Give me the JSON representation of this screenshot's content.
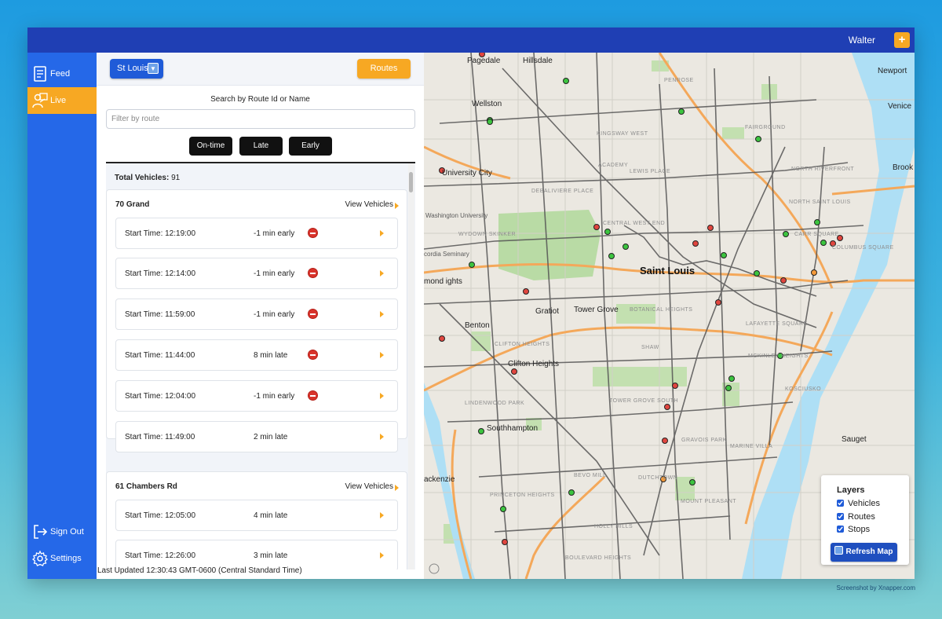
{
  "app": {
    "username": "Walter",
    "add_label": "+"
  },
  "sidebar": {
    "items": [
      {
        "label": "Feed",
        "icon": "document-icon"
      },
      {
        "label": "Live",
        "icon": "person-presentation-icon",
        "active": true
      }
    ],
    "bottom": [
      {
        "label": "Sign Out",
        "icon": "sign-out-icon"
      },
      {
        "label": "Settings",
        "icon": "gear-icon"
      }
    ]
  },
  "panel": {
    "city": "St Louis",
    "routes_label": "Routes",
    "search_label": "Search by Route Id or Name",
    "filter_placeholder": "Filter by route",
    "filters": [
      "On-time",
      "Late",
      "Early"
    ],
    "total_label": "Total Vehicles:",
    "total_value": "91",
    "view_vehicles_label": "View Vehicles",
    "routes": [
      {
        "name": "70 Grand",
        "trips": [
          {
            "start": "Start Time: 12:19:00",
            "status": "-1 min early",
            "alert": true
          },
          {
            "start": "Start Time: 12:14:00",
            "status": "-1 min early",
            "alert": true
          },
          {
            "start": "Start Time: 11:59:00",
            "status": "-1 min early",
            "alert": true
          },
          {
            "start": "Start Time: 11:44:00",
            "status": "8 min late",
            "alert": true
          },
          {
            "start": "Start Time: 12:04:00",
            "status": "-1 min early",
            "alert": true
          },
          {
            "start": "Start Time: 11:49:00",
            "status": "2 min late",
            "alert": false
          }
        ]
      },
      {
        "name": "61 Chambers Rd",
        "trips": [
          {
            "start": "Start Time: 12:05:00",
            "status": "4 min late",
            "alert": false
          },
          {
            "start": "Start Time: 12:26:00",
            "status": "3 min late",
            "alert": false
          }
        ]
      }
    ],
    "last_updated": "Last Updated 12:30:43 GMT-0600 (Central Standard Time)"
  },
  "map": {
    "labels": {
      "pagedale": "Pagedale",
      "hillsdale": "Hillsdale",
      "wellston": "Wellston",
      "university_city": "University City",
      "washington_university": "Washington University",
      "saint_louis": "Saint Louis",
      "benton": "Benton",
      "gratiot": "Gratiot",
      "tower_grove": "Tower Grove",
      "clifton_heights": "Clifton Heights",
      "southhampton": "Southhampton",
      "mackenzie": "ackenzie",
      "richmond_heights": "mond\nights",
      "newport": "Newport",
      "venice": "Venice",
      "brooklyn": "Brook",
      "sauget": "Sauget",
      "concordia": "cordia Seminary",
      "academy": "ACADEMY",
      "kingsway": "KINGSWAY WEST",
      "penrose": "PENROSE",
      "fairground": "FAIRGROUND",
      "north_riverfront": "NORTH RIVERFRONT",
      "north_saint_louis": "NORTH SAINT LOUIS",
      "debaliviere": "DEBALIVIERE PLACE",
      "lewis_place": "LEWIS PLACE",
      "central_west_end": "CENTRAL WEST END",
      "wydown_skinker": "WYDOWN SKINKER",
      "botanical_heights": "BOTANICAL HEIGHTS",
      "lafayette_square": "LAFAYETTE SQUARE",
      "mckinley_heights": "MCKINLEY HEIGHTS",
      "clifton_heights_dist": "CLIFTON HEIGHTS",
      "shaw": "SHAW",
      "lindenwood_park": "LINDENWOOD PARK",
      "tower_grove_south": "TOWER GROVE SOUTH",
      "gravois_park": "GRAVOIS PARK",
      "marine_villa": "MARINE VILLA",
      "kosciusko": "KOSCIUSKO",
      "bevo_mill": "BEVO MILL",
      "dutchtown": "DUTCHTOWN",
      "princeton_heights": "PRINCETON HEIGHTS",
      "mount_pleasant": "MOUNT PLEASANT",
      "holly_hills": "HOLLY HILLS",
      "boulevard_heights": "BOULEVARD HEIGHTS",
      "carr_square": "CARR SQUARE",
      "columbus_square": "COLUMBUS SQUARE"
    }
  },
  "layers": {
    "title": "Layers",
    "items": [
      {
        "label": "Vehicles",
        "checked": true
      },
      {
        "label": "Routes",
        "checked": true
      },
      {
        "label": "Stops",
        "checked": true
      }
    ],
    "refresh_label": "Refresh Map"
  },
  "credit": "Screenshot by Xnapper.com",
  "colors": {
    "topbar": "#1f3fb4",
    "sidebar": "#2568e8",
    "accent": "#f7a823",
    "vehicle_ontime": "#3cc43f",
    "vehicle_late": "#e0463f",
    "vehicle_early": "#f49a3a"
  }
}
